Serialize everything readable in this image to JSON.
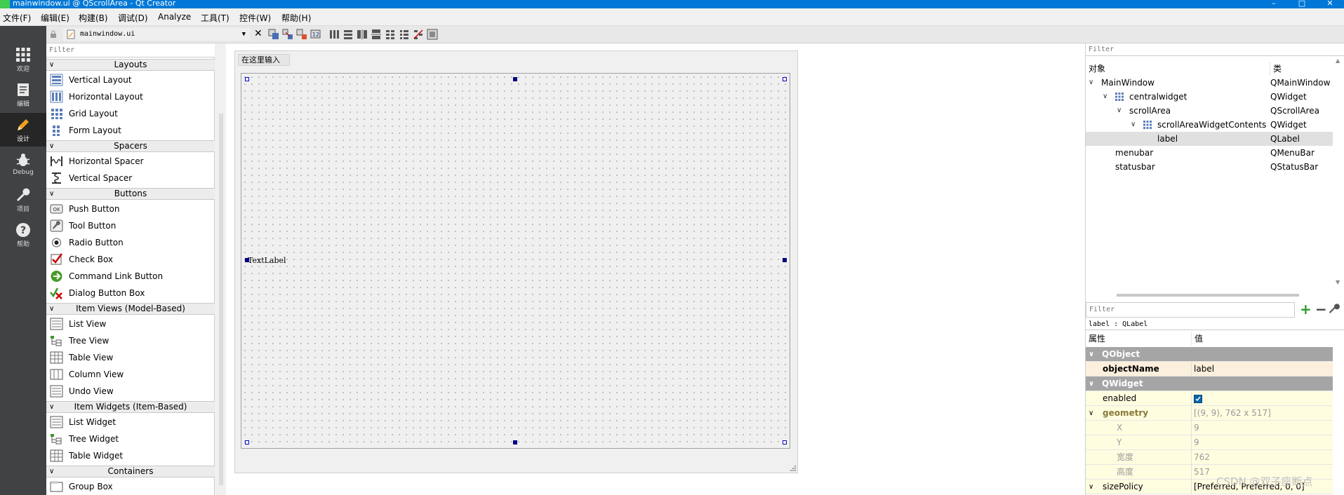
{
  "window": {
    "title": "mainwindow.ui @ QScrollArea - Qt Creator"
  },
  "menu": [
    "文件(F)",
    "编辑(E)",
    "构建(B)",
    "调试(D)",
    "Analyze",
    "工具(T)",
    "控件(W)",
    "帮助(H)"
  ],
  "modes": [
    {
      "label": "欢迎",
      "icon": "grid-icon"
    },
    {
      "label": "编辑",
      "icon": "document-icon"
    },
    {
      "label": "设计",
      "icon": "pencil-icon"
    },
    {
      "label": "Debug",
      "icon": "bug-icon"
    },
    {
      "label": "项目",
      "icon": "wrench-icon"
    },
    {
      "label": "帮助",
      "icon": "help-icon"
    }
  ],
  "toolbar": {
    "open_file": "mainwindow.ui"
  },
  "widget_box": {
    "filter_placeholder": "Filter",
    "categories": [
      {
        "title": "Layouts",
        "items": [
          "Vertical Layout",
          "Horizontal Layout",
          "Grid Layout",
          "Form Layout"
        ]
      },
      {
        "title": "Spacers",
        "items": [
          "Horizontal Spacer",
          "Vertical Spacer"
        ]
      },
      {
        "title": "Buttons",
        "items": [
          "Push Button",
          "Tool Button",
          "Radio Button",
          "Check Box",
          "Command Link Button",
          "Dialog Button Box"
        ]
      },
      {
        "title": "Item Views (Model-Based)",
        "items": [
          "List View",
          "Tree View",
          "Table View",
          "Column View",
          "Undo View"
        ]
      },
      {
        "title": "Item Widgets (Item-Based)",
        "items": [
          "List Widget",
          "Tree Widget",
          "Table Widget"
        ]
      },
      {
        "title": "Containers",
        "items": [
          "Group Box"
        ]
      }
    ]
  },
  "form": {
    "type_here": "在这里输入",
    "label_text": "TextLabel"
  },
  "object_inspector": {
    "filter_placeholder": "Filter",
    "col_object": "对象",
    "col_class": "类",
    "rows": [
      {
        "name": "MainWindow",
        "class": "QMainWindow"
      },
      {
        "name": "centralwidget",
        "class": "QWidget"
      },
      {
        "name": "scrollArea",
        "class": "QScrollArea"
      },
      {
        "name": "scrollAreaWidgetContents",
        "class": "QWidget"
      },
      {
        "name": "label",
        "class": "QLabel"
      },
      {
        "name": "menubar",
        "class": "QMenuBar"
      },
      {
        "name": "statusbar",
        "class": "QStatusBar"
      }
    ]
  },
  "property_editor": {
    "filter_placeholder": "Filter",
    "object_label": "label : QLabel",
    "col_property": "属性",
    "col_value": "值",
    "rows": [
      {
        "name": "QObject",
        "value": ""
      },
      {
        "name": "objectName",
        "value": "label"
      },
      {
        "name": "QWidget",
        "value": ""
      },
      {
        "name": "enabled",
        "value": "",
        "checked": true
      },
      {
        "name": "geometry",
        "value": "[(9, 9), 762 x 517]"
      },
      {
        "name": "X",
        "value": "9"
      },
      {
        "name": "Y",
        "value": "9"
      },
      {
        "name": "宽度",
        "value": "762"
      },
      {
        "name": "高度",
        "value": "517"
      },
      {
        "name": "sizePolicy",
        "value": "[Preferred, Preferred, 0, 0]"
      }
    ]
  },
  "watermark": "CSDN @双子座断点"
}
